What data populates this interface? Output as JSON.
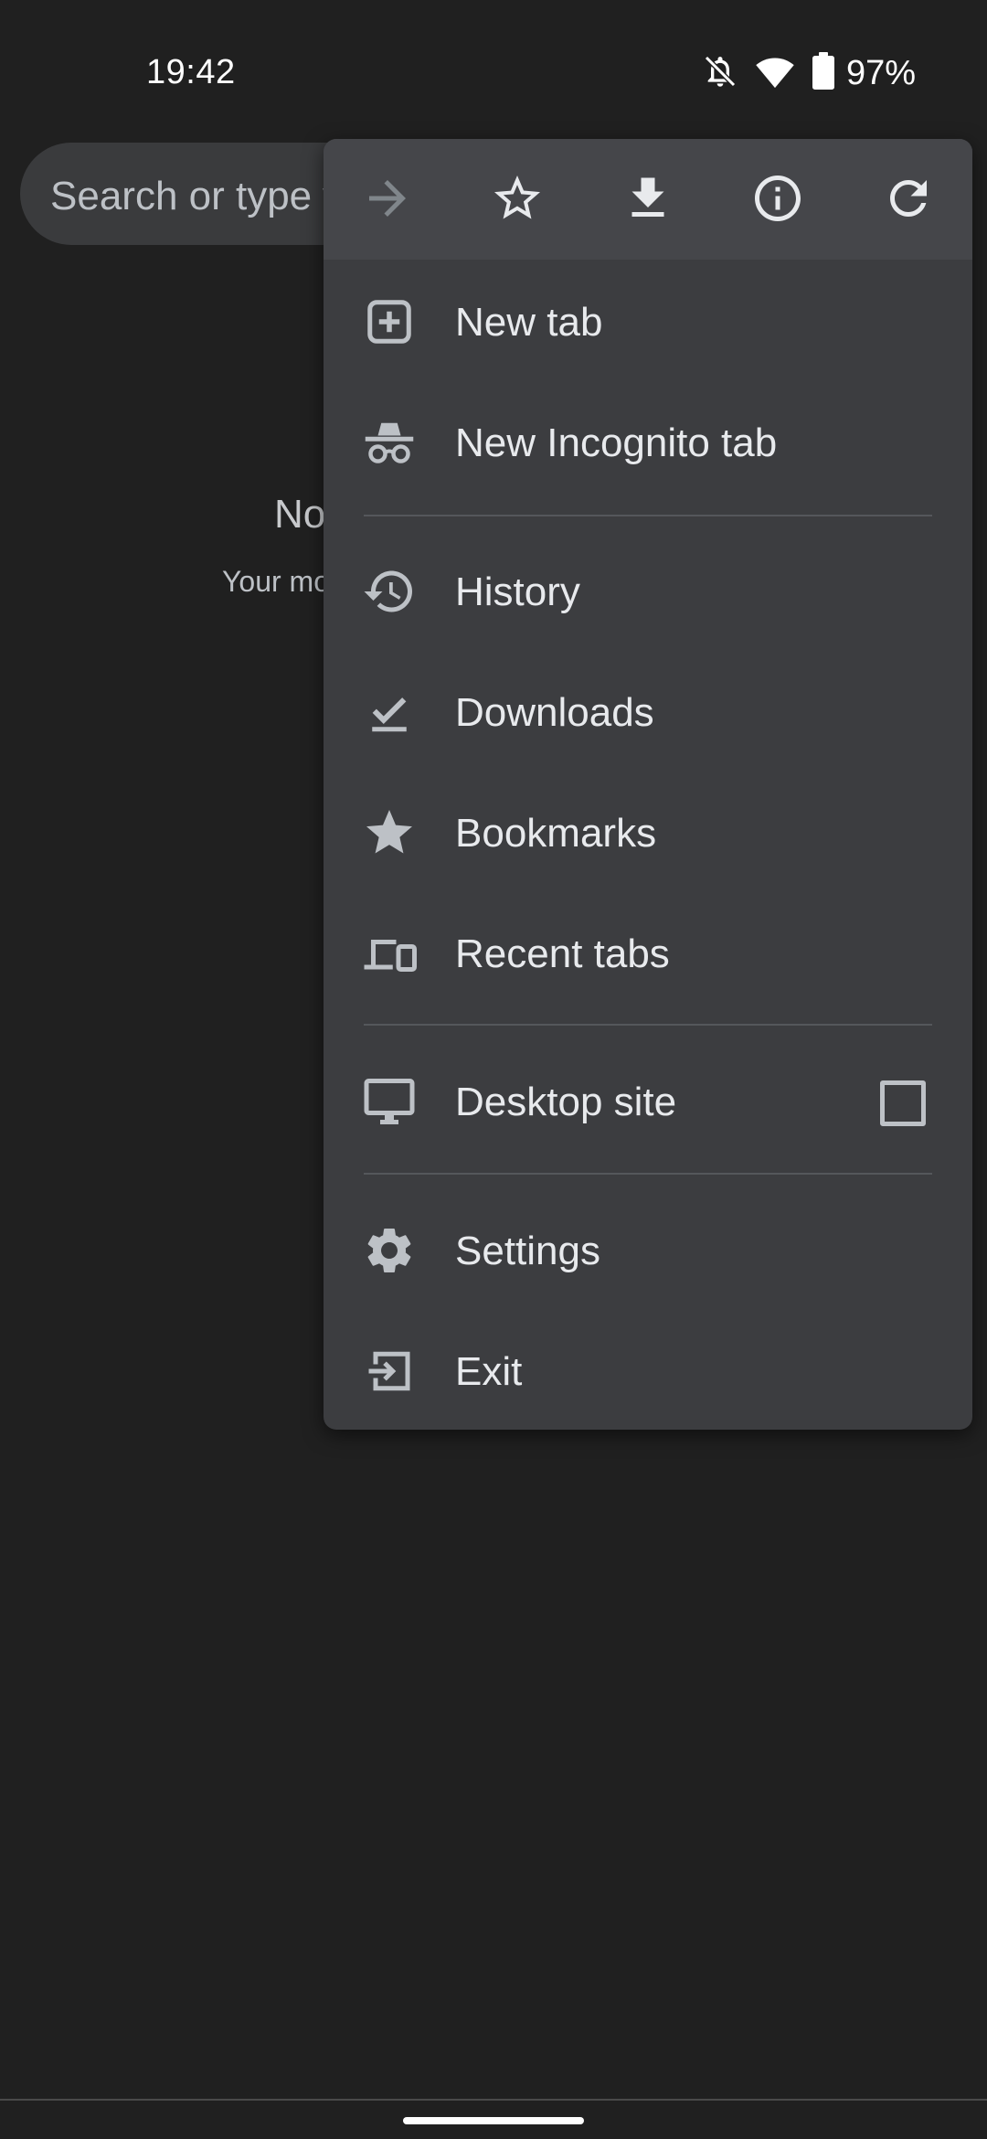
{
  "status_bar": {
    "time": "19:42",
    "battery": "97%",
    "icons": [
      "notifications-off-icon",
      "wifi-icon",
      "battery-icon"
    ]
  },
  "omnibox": {
    "placeholder": "Search or type w"
  },
  "background": {
    "title": "No",
    "subtitle": "Your mo"
  },
  "toolbar": {
    "icons": [
      "forward-arrow-icon",
      "bookmark-star-icon",
      "download-icon",
      "info-icon",
      "reload-icon"
    ]
  },
  "menu": {
    "items": [
      {
        "label": "New tab",
        "icon": "new-tab-icon"
      },
      {
        "label": "New Incognito tab",
        "icon": "incognito-icon"
      },
      {
        "label": "History",
        "icon": "history-icon"
      },
      {
        "label": "Downloads",
        "icon": "downloads-icon"
      },
      {
        "label": "Bookmarks",
        "icon": "star-filled-icon"
      },
      {
        "label": "Recent tabs",
        "icon": "devices-icon"
      },
      {
        "label": "Desktop site",
        "icon": "monitor-icon",
        "checked": false
      },
      {
        "label": "Settings",
        "icon": "gear-icon"
      },
      {
        "label": "Exit",
        "icon": "exit-icon"
      }
    ]
  },
  "colors": {
    "background": "#202020",
    "menu": "#3c3d40",
    "toolbar": "#45464a",
    "omnibox": "#3a3b3d",
    "text": "#e8eaed",
    "icon": "#bdc1c6",
    "disabled_icon": "#80868b"
  }
}
